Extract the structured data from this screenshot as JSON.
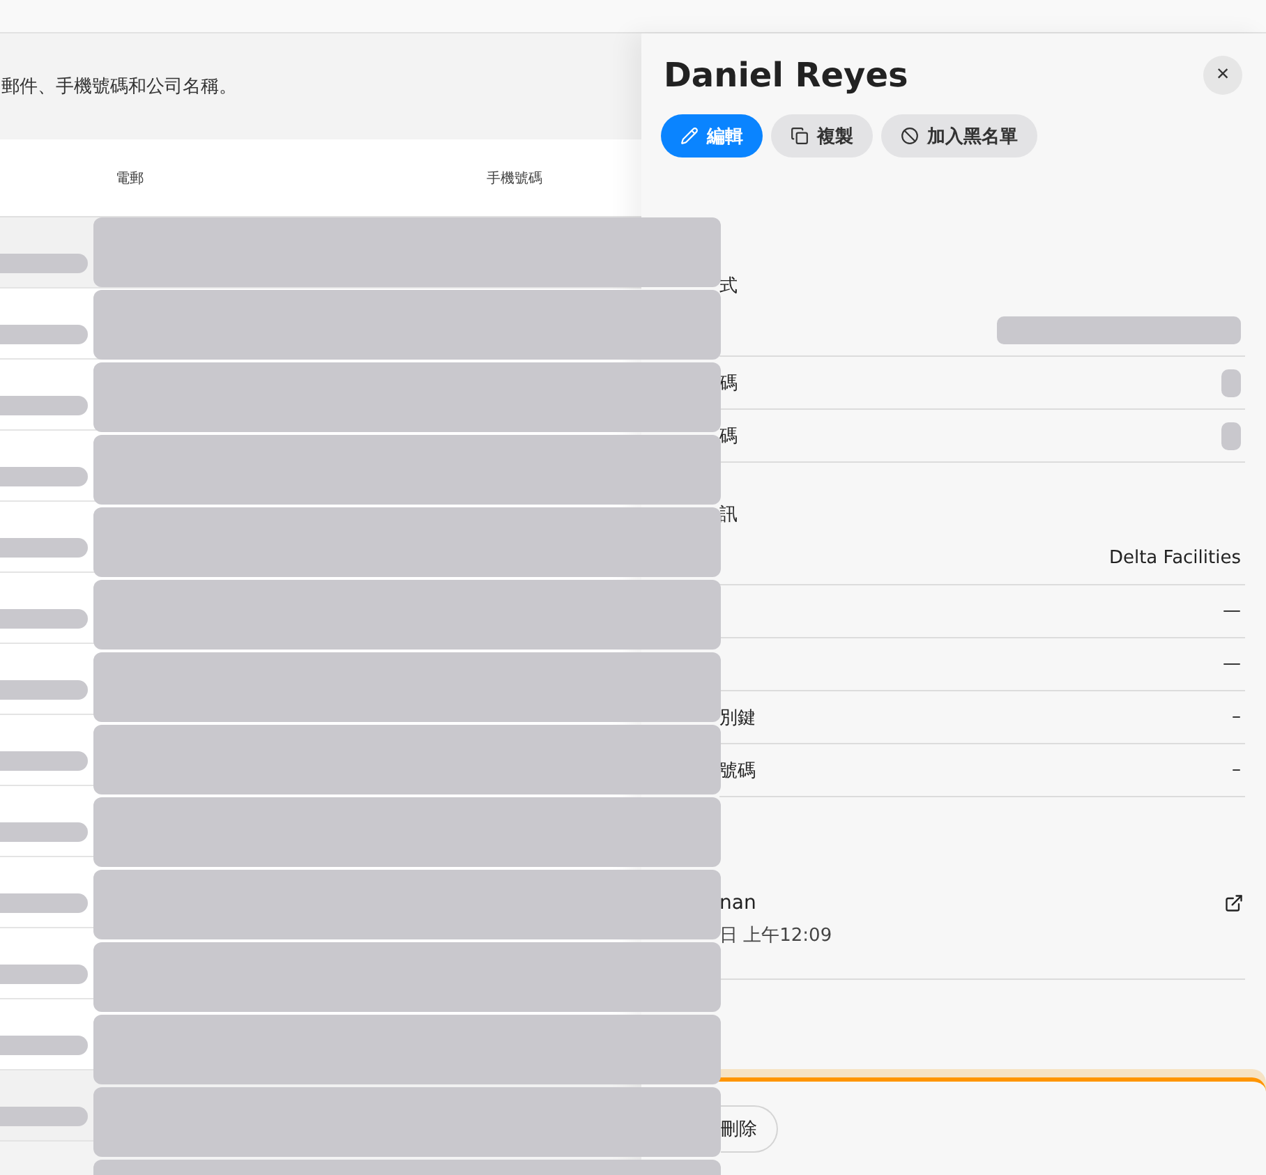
{
  "page": {
    "description": "郵件、手機號碼和公司名稱。"
  },
  "table": {
    "columns": [
      "電郵",
      "手機號碼"
    ]
  },
  "drawer": {
    "title": "Daniel Reyes",
    "close": "×",
    "actions": [
      {
        "label": "編輯",
        "kind": "primary"
      },
      {
        "label": "複製",
        "kind": "secondary"
      },
      {
        "label": "加入黑名單",
        "kind": "secondary"
      }
    ],
    "items": [
      {
        "kind": "heading",
        "label": "式"
      },
      {
        "kind": "masked"
      },
      {
        "kind": "masked",
        "label": "碼"
      },
      {
        "kind": "masked",
        "label": "碼"
      },
      {
        "kind": "heading",
        "label": "訊"
      },
      {
        "kind": "row",
        "value": "Delta Facilities"
      },
      {
        "kind": "row",
        "value": "—"
      },
      {
        "kind": "row",
        "value": "—"
      },
      {
        "kind": "row",
        "label": "別鍵",
        "value": "–"
      },
      {
        "kind": "row",
        "label": "號碼",
        "value": "–"
      },
      {
        "kind": "link",
        "label": "nan",
        "sub": "日 上午12:09"
      }
    ],
    "footer": {
      "button": "刪除"
    }
  }
}
